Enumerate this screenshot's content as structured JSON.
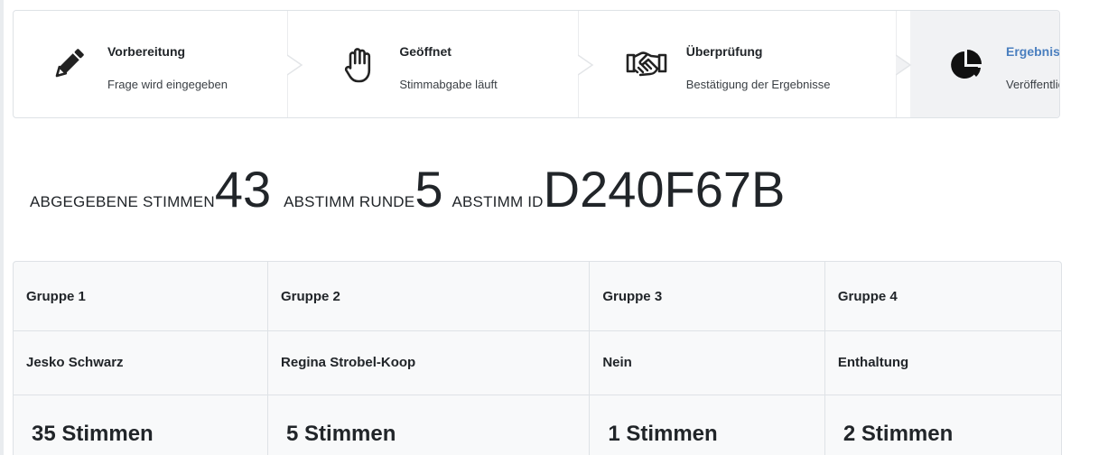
{
  "steps": [
    {
      "title": "Vorbereitung",
      "subtitle": "Frage wird eingegeben",
      "icon": "pencil-icon"
    },
    {
      "title": "Geöffnet",
      "subtitle": "Stimmabgabe läuft",
      "icon": "raised-hand-icon"
    },
    {
      "title": "Überprüfung",
      "subtitle": "Bestätigung der Ergebnisse",
      "icon": "handshake-icon"
    },
    {
      "title": "Ergebnis",
      "subtitle": "Veröffentlich",
      "icon": "pie-chart-icon",
      "active": true
    }
  ],
  "stats": {
    "votes_label": "ABGEGEBENE STIMMEN",
    "votes_value": "43",
    "round_label": "ABSTIMM RUNDE",
    "round_value": "5",
    "id_label": "ABSTIMM ID",
    "id_value": "D240F67B"
  },
  "results": {
    "groups": [
      "Gruppe 1",
      "Gruppe 2",
      "Gruppe 3",
      "Gruppe 4"
    ],
    "options": [
      "Jesko Schwarz",
      "Regina Strobel-Koop",
      "Nein",
      "Enthaltung"
    ],
    "votes": [
      "35 Stimmen",
      "5 Stimmen",
      "1 Stimmen",
      "2 Stimmen"
    ]
  },
  "colors": {
    "active_step_title": "#4a7fbf",
    "active_step_bg": "#f1f2f4",
    "border": "#dee2e6",
    "table_bg": "#f8f9fa"
  }
}
